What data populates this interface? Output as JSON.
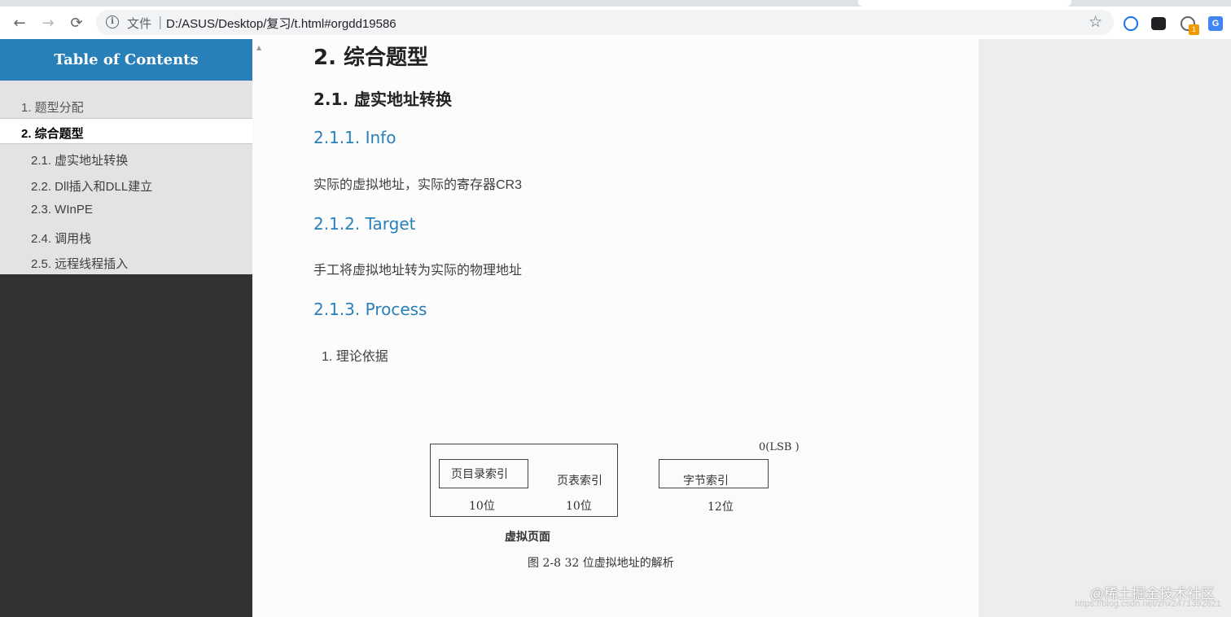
{
  "browser": {
    "url_scheme": "文件",
    "url_separator": "|",
    "url": "D:/ASUS/Desktop/复习/t.html#orgdd19586",
    "ext_badge": "1",
    "ext_translate": "G"
  },
  "sidebar": {
    "title": "Table of Contents",
    "items": [
      {
        "label": "1. 题型分配"
      },
      {
        "label": "2. 综合题型"
      },
      {
        "label": "2.1. 虚实地址转换"
      },
      {
        "label": "2.2. Dll插入和DLL建立"
      },
      {
        "label": "2.3. WInPE"
      },
      {
        "label": "2.4. 调用栈"
      },
      {
        "label": "2.5. 远程线程插入"
      }
    ]
  },
  "content": {
    "h2": "2. 综合题型",
    "h3": "2.1. 虚实地址转换",
    "sections": [
      {
        "heading": "2.1.1. Info",
        "text": "实际的虚拟地址，实际的寄存器CR3"
      },
      {
        "heading": "2.1.2. Target",
        "text": "手工将虚拟地址转为实际的物理地址"
      },
      {
        "heading": "2.1.3. Process"
      }
    ],
    "list_item": "1. 理论依据"
  },
  "figure": {
    "lsb_label": "0(LSB )",
    "box1": "页目录索引",
    "box2": "页表索引",
    "box3": "字节索引",
    "bits1": "10位",
    "bits2": "10位",
    "bits3": "12位",
    "page_label": "虚拟页面",
    "caption": "图 2-8    32 位虚拟地址的解析"
  },
  "watermark": {
    "main": "@稀土掘金技术社区",
    "sub": "https://blog.csdn.net/zhx2471392621"
  }
}
